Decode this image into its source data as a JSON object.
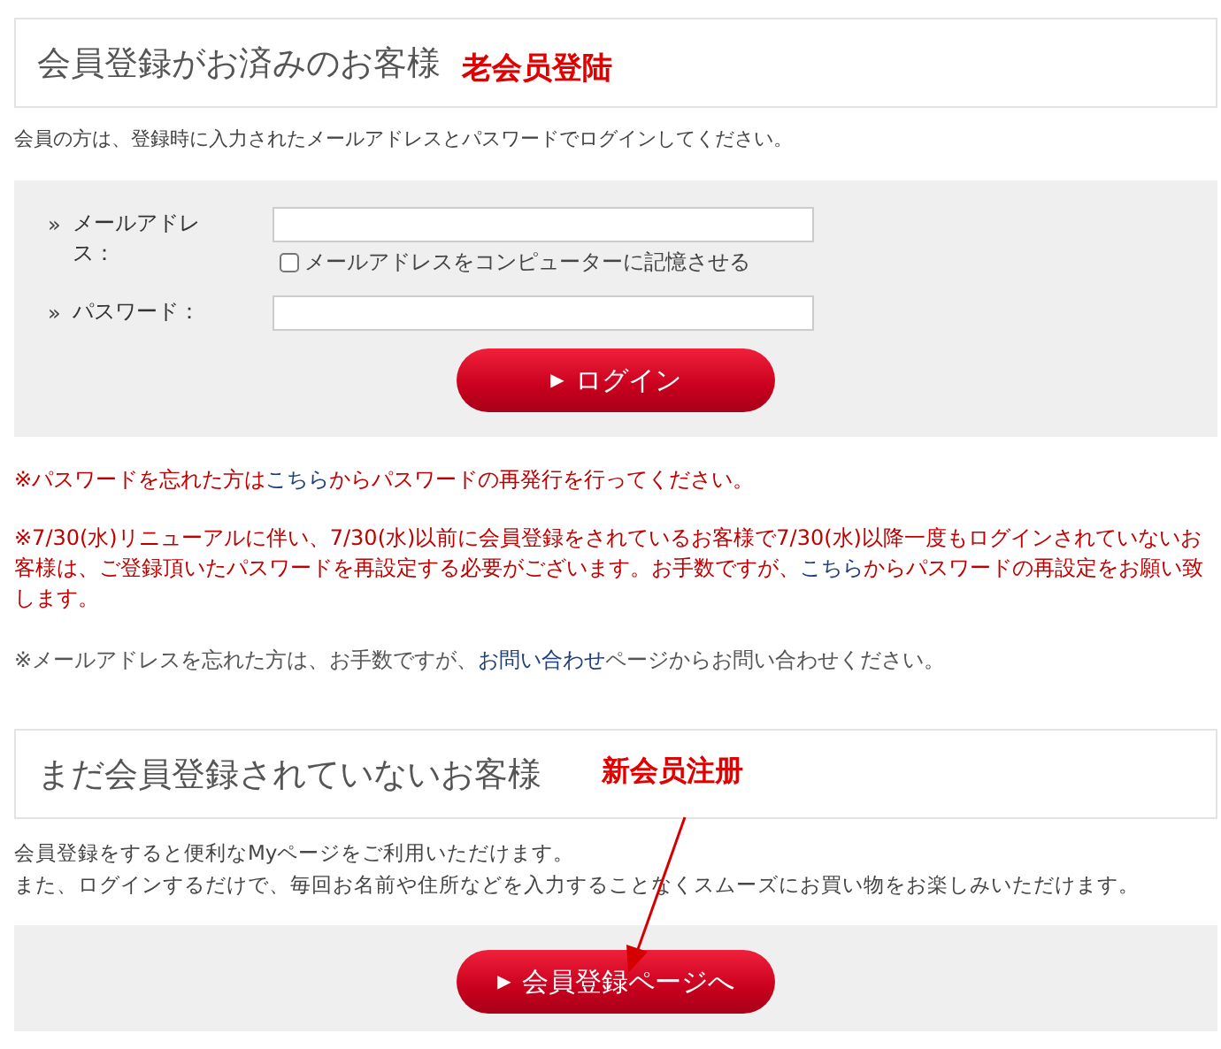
{
  "login_section": {
    "heading": "会員登録がお済みのお客様",
    "annotation": "老会员登陆",
    "intro": "会員の方は、登録時に入力されたメールアドレスとパスワードでログインしてください。",
    "fields": [
      {
        "marker": "»",
        "label": "メールアドレス：",
        "remember": {
          "label": "メールアドレスをコンピューターに記憶させる",
          "checked": false
        }
      },
      {
        "marker": "»",
        "label": "パスワード："
      }
    ],
    "button": {
      "icon": "▶",
      "label": "ログイン"
    },
    "notes": [
      {
        "kind": "alert",
        "parts": [
          {
            "kind": "text",
            "text": "※パスワードを忘れた方は"
          },
          {
            "kind": "link",
            "text": "こちら"
          },
          {
            "kind": "text",
            "text": "からパスワードの再発行を行ってください。"
          }
        ]
      },
      {
        "kind": "alert",
        "parts": [
          {
            "kind": "text",
            "text": "※7/30(水)リニューアルに伴い、7/30(水)以前に会員登録をされているお客様で7/30(水)以降一度もログインされていないお客様は、ご登録頂いたパスワードを再設定する必要がございます。お手数ですが、"
          },
          {
            "kind": "link",
            "text": "こちら"
          },
          {
            "kind": "text",
            "text": "からパスワードの再設定をお願い致します。"
          }
        ]
      },
      {
        "kind": "info",
        "parts": [
          {
            "kind": "text",
            "text": "※メールアドレスを忘れた方は、お手数ですが、"
          },
          {
            "kind": "link",
            "text": "お問い合わせ"
          },
          {
            "kind": "text",
            "text": "ページからお問い合わせください。"
          }
        ]
      }
    ]
  },
  "register_section": {
    "heading": "まだ会員登録されていないお客様",
    "annotation": "新会员注册",
    "lines": [
      "会員登録をすると便利なMyページをご利用いただけます。",
      "また、ログインするだけで、毎回お名前や住所などを入力することなくスムーズにお買い物をお楽しみいただけます。"
    ],
    "button": {
      "icon": "▶",
      "label": "会員登録ページへ"
    }
  }
}
